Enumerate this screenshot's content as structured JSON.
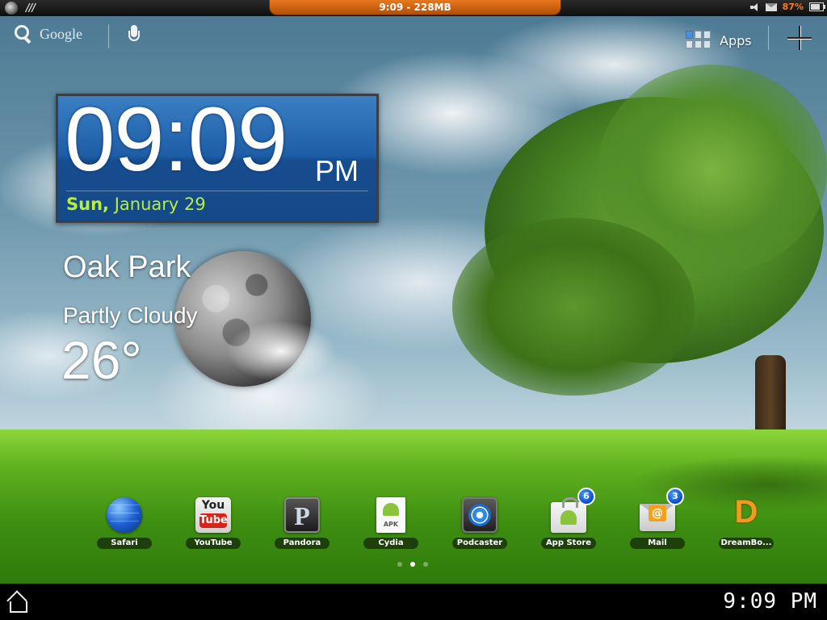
{
  "status_bar": {
    "center_text": "9:09 - 228MB",
    "battery_percent": "87%",
    "icons": [
      "app-switcher-icon",
      "signal-bars-icon",
      "volume-muted-icon",
      "mail-notification-icon",
      "battery-icon"
    ]
  },
  "search": {
    "label": "Google"
  },
  "apps": {
    "label": "Apps"
  },
  "clock": {
    "time": "09:09",
    "ampm": "PM",
    "day": "Sun,",
    "date": "January 29"
  },
  "weather": {
    "city": "Oak Park",
    "condition": "Partly Cloudy",
    "temperature": "26°"
  },
  "dock": {
    "apps": [
      {
        "label": "Safari",
        "icon": "safari-icon"
      },
      {
        "label": "YouTube",
        "icon": "youtube-icon",
        "icon_text_top": "You",
        "icon_text_bottom": "Tube"
      },
      {
        "label": "Pandora",
        "icon": "pandora-icon",
        "icon_text": "P"
      },
      {
        "label": "Cydia",
        "icon": "apk-file-icon",
        "icon_text": "APK"
      },
      {
        "label": "Podcaster",
        "icon": "podcaster-icon"
      },
      {
        "label": "App Store",
        "icon": "android-market-icon",
        "badge": "6"
      },
      {
        "label": "Mail",
        "icon": "mail-icon",
        "badge": "3",
        "icon_text": "@"
      },
      {
        "label": "DreamBo...",
        "icon": "dreamboard-icon",
        "icon_text": "D"
      }
    ]
  },
  "pager": {
    "page_count": 3,
    "active_page": 2
  },
  "nav_bar": {
    "time": "9:09  PM"
  },
  "colors": {
    "accent_orange": "#e06d14",
    "clock_blue": "#1d5ea7",
    "date_green": "#b6f03a",
    "badge_blue": "#0b48c8"
  }
}
